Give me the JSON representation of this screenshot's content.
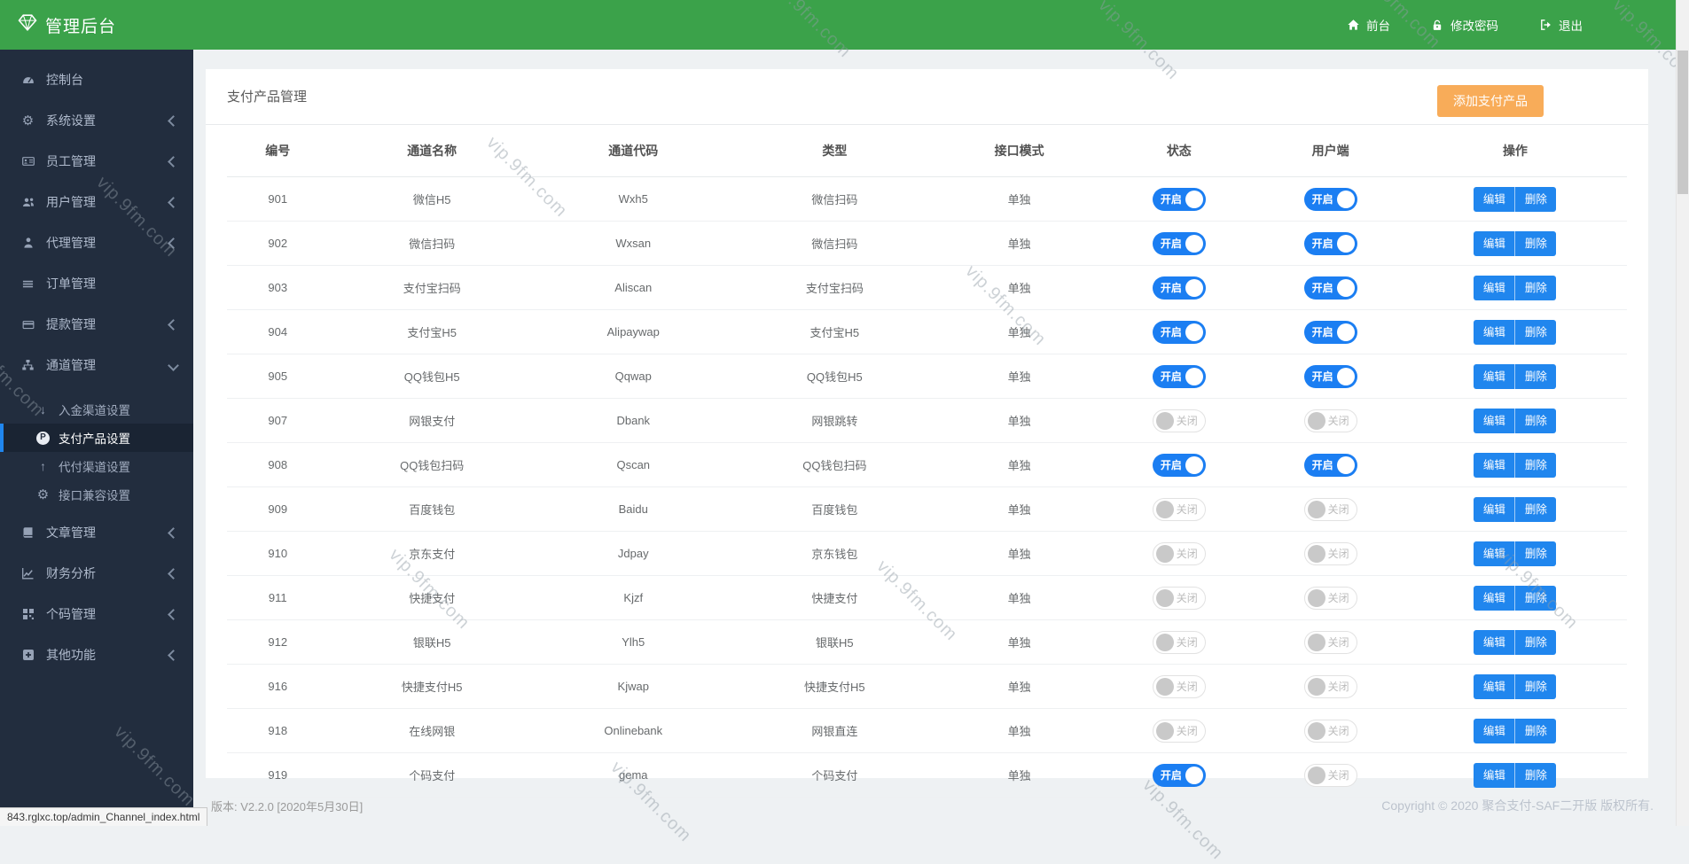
{
  "topbar": {
    "brand": "管理后台",
    "links": [
      {
        "key": "frontend",
        "label": "前台",
        "icon": "home-icon"
      },
      {
        "key": "change-password",
        "label": "修改密码",
        "icon": "unlock-icon"
      },
      {
        "key": "logout",
        "label": "退出",
        "icon": "logout-icon"
      }
    ]
  },
  "sidebar": {
    "items": [
      {
        "key": "dashboard",
        "label": "控制台",
        "icon": "dashboard-icon",
        "chevron": null
      },
      {
        "key": "system-settings",
        "label": "系统设置",
        "icon": "gears-icon",
        "chevron": "left"
      },
      {
        "key": "staff",
        "label": "员工管理",
        "icon": "idcard-icon",
        "chevron": "left"
      },
      {
        "key": "users",
        "label": "用户管理",
        "icon": "users-icon",
        "chevron": "left"
      },
      {
        "key": "agents",
        "label": "代理管理",
        "icon": "agent-icon",
        "chevron": "left"
      },
      {
        "key": "orders",
        "label": "订单管理",
        "icon": "list-icon",
        "chevron": null
      },
      {
        "key": "withdrawals",
        "label": "提款管理",
        "icon": "withdraw-icon",
        "chevron": "left"
      },
      {
        "key": "channels",
        "label": "通道管理",
        "icon": "channel-icon",
        "chevron": "down",
        "expanded": true,
        "submenu": [
          {
            "key": "deposit-channel",
            "label": "入金渠道设置",
            "icon": "level-down-icon",
            "active": false
          },
          {
            "key": "payment-product",
            "label": "支付产品设置",
            "icon": "p-circle-icon",
            "active": true
          },
          {
            "key": "payout-channel",
            "label": "代付渠道设置",
            "icon": "level-up-icon",
            "active": false
          },
          {
            "key": "interface-compat",
            "label": "接口兼容设置",
            "icon": "gears-icon",
            "active": false
          }
        ]
      },
      {
        "key": "articles",
        "label": "文章管理",
        "icon": "article-icon",
        "chevron": "left"
      },
      {
        "key": "finance",
        "label": "财务分析",
        "icon": "finance-icon",
        "chevron": "left"
      },
      {
        "key": "personal-qrcode",
        "label": "个码管理",
        "icon": "qrcode-icon",
        "chevron": "left"
      },
      {
        "key": "other",
        "label": "其他功能",
        "icon": "plus-square-icon",
        "chevron": "left"
      }
    ]
  },
  "page": {
    "title": "支付产品管理",
    "add_button": "添加支付产品"
  },
  "table": {
    "headers": [
      "编号",
      "通道名称",
      "通道代码",
      "类型",
      "接口模式",
      "状态",
      "用户端",
      "操作"
    ],
    "rows": [
      {
        "id": "901",
        "name": "微信H5",
        "code": "Wxh5",
        "type": "微信扫码",
        "mode": "单独",
        "status": "on",
        "client": "on"
      },
      {
        "id": "902",
        "name": "微信扫码",
        "code": "Wxsan",
        "type": "微信扫码",
        "mode": "单独",
        "status": "on",
        "client": "on"
      },
      {
        "id": "903",
        "name": "支付宝扫码",
        "code": "Aliscan",
        "type": "支付宝扫码",
        "mode": "单独",
        "status": "on",
        "client": "on"
      },
      {
        "id": "904",
        "name": "支付宝H5",
        "code": "Alipaywap",
        "type": "支付宝H5",
        "mode": "单独",
        "status": "on",
        "client": "on"
      },
      {
        "id": "905",
        "name": "QQ钱包H5",
        "code": "Qqwap",
        "type": "QQ钱包H5",
        "mode": "单独",
        "status": "on",
        "client": "on"
      },
      {
        "id": "907",
        "name": "网银支付",
        "code": "Dbank",
        "type": "网银跳转",
        "mode": "单独",
        "status": "off",
        "client": "off"
      },
      {
        "id": "908",
        "name": "QQ钱包扫码",
        "code": "Qscan",
        "type": "QQ钱包扫码",
        "mode": "单独",
        "status": "on",
        "client": "on"
      },
      {
        "id": "909",
        "name": "百度钱包",
        "code": "Baidu",
        "type": "百度钱包",
        "mode": "单独",
        "status": "off",
        "client": "off"
      },
      {
        "id": "910",
        "name": "京东支付",
        "code": "Jdpay",
        "type": "京东钱包",
        "mode": "单独",
        "status": "off",
        "client": "off"
      },
      {
        "id": "911",
        "name": "快捷支付",
        "code": "Kjzf",
        "type": "快捷支付",
        "mode": "单独",
        "status": "off",
        "client": "off"
      },
      {
        "id": "912",
        "name": "银联H5",
        "code": "Ylh5",
        "type": "银联H5",
        "mode": "单独",
        "status": "off",
        "client": "off"
      },
      {
        "id": "916",
        "name": "快捷支付H5",
        "code": "Kjwap",
        "type": "快捷支付H5",
        "mode": "单独",
        "status": "off",
        "client": "off"
      },
      {
        "id": "918",
        "name": "在线网银",
        "code": "Onlinebank",
        "type": "网银直连",
        "mode": "单独",
        "status": "off",
        "client": "off"
      },
      {
        "id": "919",
        "name": "个码支付",
        "code": "gema",
        "type": "个码支付",
        "mode": "单独",
        "status": "on",
        "client": "off"
      }
    ]
  },
  "toggle": {
    "on": "开启",
    "off": "关闭"
  },
  "actions": {
    "edit": "编辑",
    "delete": "删除"
  },
  "footer": {
    "version": "版本: V2.2.0 [2020年5月30日]",
    "copyright": "Copyright © 2020 聚合支付-SAF二开版 版权所有."
  },
  "statusbar": {
    "url": "843.rglxc.top/admin_Channel_index.html"
  },
  "watermark": {
    "text": "vip.9fm.com"
  },
  "colors": {
    "topbar_green": "#3ba24a",
    "accent_blue": "#1b7ef2",
    "button_blue": "#2086ee",
    "warning_orange": "#f8ac59",
    "sidebar_dark": "#222d3e"
  }
}
